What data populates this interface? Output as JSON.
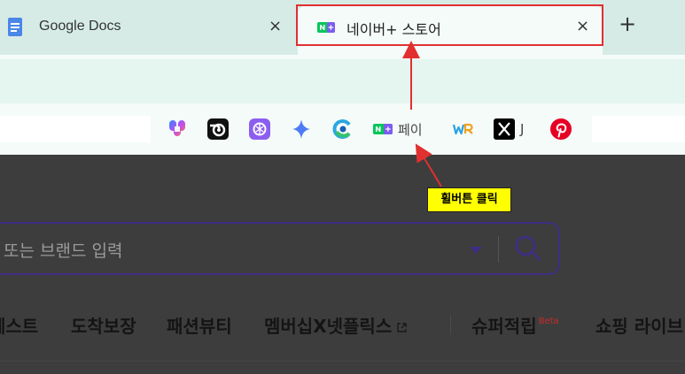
{
  "tabs": [
    {
      "title": "Google Docs",
      "icon": "google-docs-icon"
    },
    {
      "title": "네이버+ 스토어",
      "icon": "naver-plus-store-icon",
      "active": true
    }
  ],
  "new_tab_symbol": "+",
  "close_symbol": "×",
  "bookmarks": [
    {
      "icon": "copilot-icon"
    },
    {
      "icon": "blender-icon"
    },
    {
      "icon": "chatgpt-icon"
    },
    {
      "icon": "gemini-icon"
    },
    {
      "icon": "edge-drop-icon"
    },
    {
      "icon": "naver-pay-icon",
      "label": "페이"
    },
    {
      "icon": "wr-icon"
    },
    {
      "icon": "x-icon",
      "label": "J"
    },
    {
      "icon": "pinterest-icon"
    }
  ],
  "search": {
    "placeholder": "또는 브랜드 입력"
  },
  "nav": {
    "items": [
      "베스트",
      "도착보장",
      "패션뷰티",
      "멤버십X넷플릭스",
      "슈퍼적립",
      "쇼핑 라이브"
    ],
    "beta_label": "Beta"
  },
  "annotation": {
    "text": "휠버튼 클릭"
  },
  "colors": {
    "annotation_red": "#e03030",
    "callout_yellow": "#ffff00",
    "search_border": "#3f2d83",
    "naver_green": "#03c75a"
  }
}
